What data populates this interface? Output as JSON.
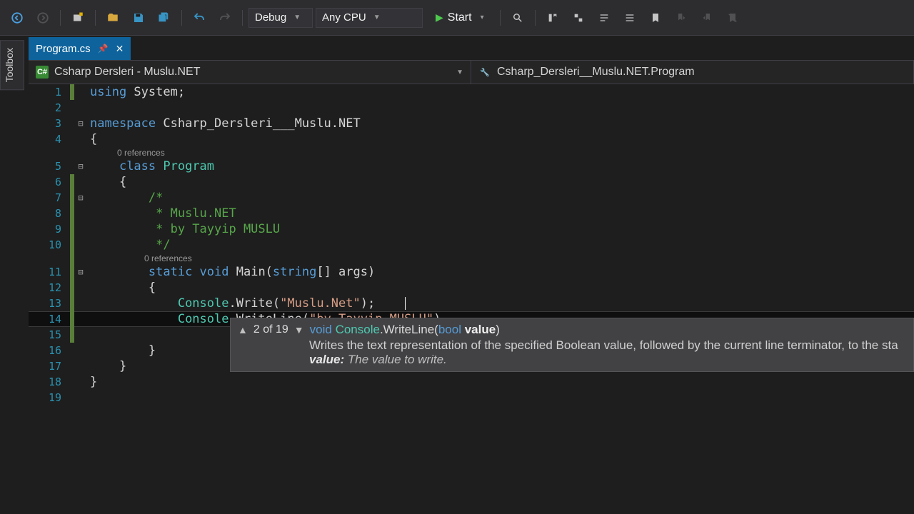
{
  "toolbar": {
    "config": "Debug",
    "platform": "Any CPU",
    "start_label": "Start"
  },
  "toolbox_label": "Toolbox",
  "tab": {
    "filename": "Program.cs"
  },
  "nav": {
    "project": "Csharp Dersleri - Muslu.NET",
    "member": "Csharp_Dersleri__Muslu.NET.Program"
  },
  "codelens": {
    "class_refs": "0 references",
    "main_refs": "0 references"
  },
  "code": {
    "l1_kw": "using",
    "l1_type": " System",
    "l1_punc": ";",
    "l3_kw": "namespace",
    "l3_name": " Csharp_Dersleri___Muslu.NET",
    "l4": "{",
    "l5_kw": "class",
    "l5_type": " Program",
    "l6": "{",
    "l7": "/*",
    "l8": " * Muslu.NET",
    "l9": " * by Tayyip MUSLU",
    "l10": " */",
    "l11_static": "static ",
    "l11_void": "void",
    "l11_main": " Main(",
    "l11_string": "string",
    "l11_args": "[] args)",
    "l12": "{",
    "l13_cls": "Console",
    "l13_mid": ".Write(",
    "l13_str": "\"Muslu.Net\"",
    "l13_end": ");",
    "l14_cls": "Console",
    "l14_mid": ".WriteLine(",
    "l14_str": "\"by Tayyip MUSLU\"",
    "l14_end": ")",
    "l14_err": "_",
    "l16": "}",
    "l17": "}",
    "l18": "}"
  },
  "sig": {
    "count": "2 of 19",
    "ret": "void ",
    "class": "Console",
    "method": ".WriteLine(",
    "ptype": "bool",
    "pname": " value",
    "close": ")",
    "desc": "Writes the text representation of the specified Boolean value, followed by the current line terminator, to the sta",
    "value_label": "value:",
    "value_desc": " The value to write."
  }
}
